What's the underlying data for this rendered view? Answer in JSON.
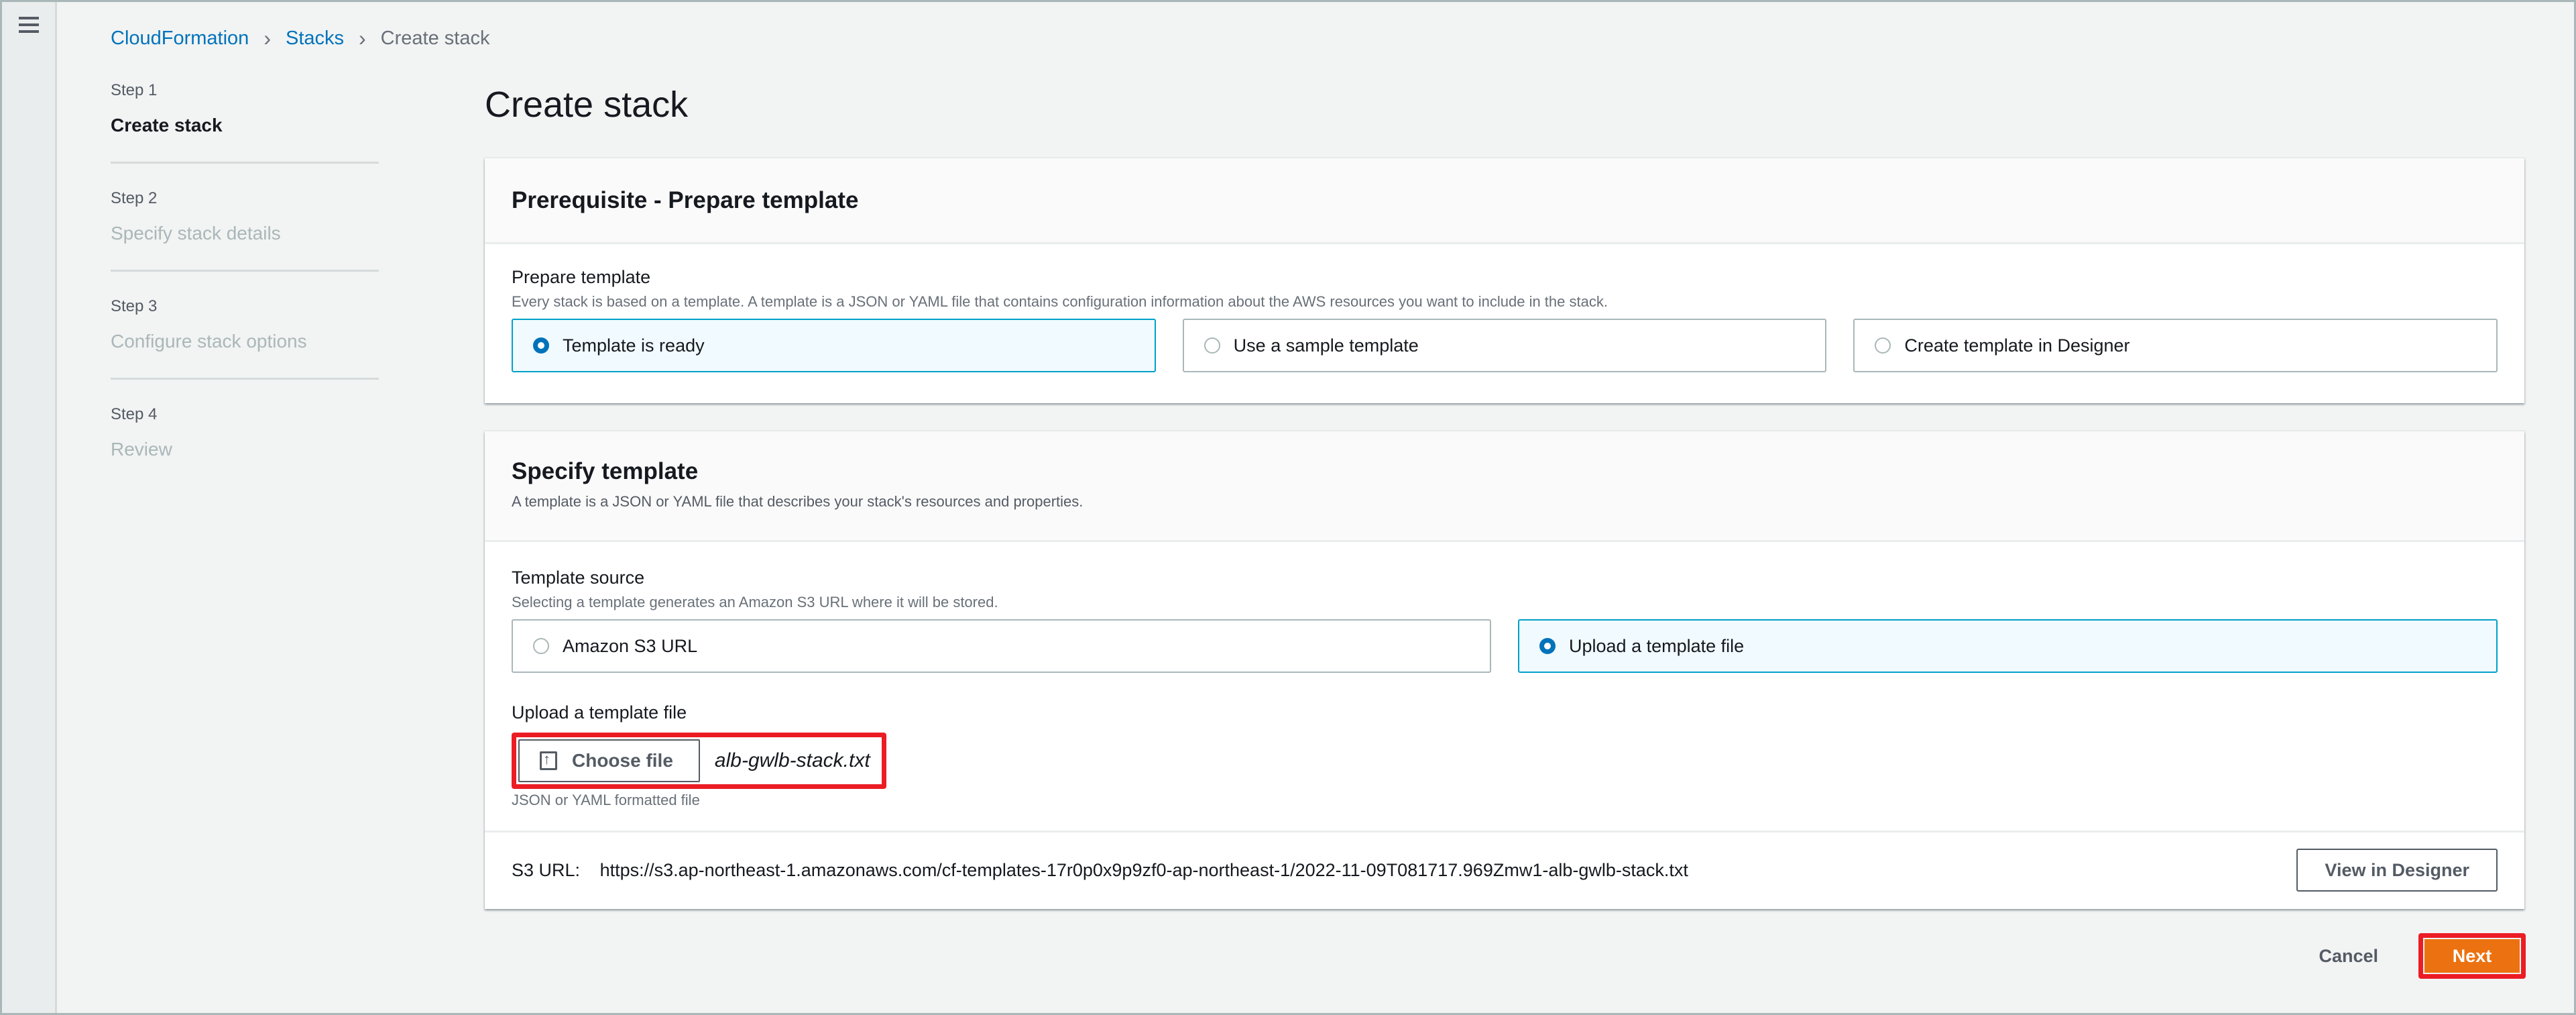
{
  "nav": {
    "menu_icon": "hamburger-menu-icon"
  },
  "breadcrumb": [
    {
      "label": "CloudFormation"
    },
    {
      "label": "Stacks"
    },
    {
      "label": "Create stack"
    }
  ],
  "steps": [
    {
      "num": "Step 1",
      "title": "Create stack",
      "active": true
    },
    {
      "num": "Step 2",
      "title": "Specify stack details",
      "active": false
    },
    {
      "num": "Step 3",
      "title": "Configure stack options",
      "active": false
    },
    {
      "num": "Step 4",
      "title": "Review",
      "active": false
    }
  ],
  "page_title": "Create stack",
  "prerequisite": {
    "title": "Prerequisite - Prepare template",
    "field_label": "Prepare template",
    "field_desc": "Every stack is based on a template. A template is a JSON or YAML file that contains configuration information about the AWS resources you want to include in the stack.",
    "options": [
      {
        "label": "Template is ready",
        "selected": true
      },
      {
        "label": "Use a sample template",
        "selected": false
      },
      {
        "label": "Create template in Designer",
        "selected": false
      }
    ]
  },
  "specify": {
    "title": "Specify template",
    "desc": "A template is a JSON or YAML file that describes your stack's resources and properties.",
    "source_label": "Template source",
    "source_desc": "Selecting a template generates an Amazon S3 URL where it will be stored.",
    "sources": [
      {
        "label": "Amazon S3 URL",
        "selected": false
      },
      {
        "label": "Upload a template file",
        "selected": true
      }
    ],
    "upload_label": "Upload a template file",
    "choose_file_label": "Choose file",
    "file_name": "alb-gwlb-stack.txt",
    "upload_hint": "JSON or YAML formatted file",
    "s3_url_label": "S3 URL:",
    "s3_url": "https://s3.ap-northeast-1.amazonaws.com/cf-templates-17r0p0x9p9zf0-ap-northeast-1/2022-11-09T081717.969Zmw1-alb-gwlb-stack.txt",
    "view_designer_label": "View in Designer"
  },
  "actions": {
    "cancel_label": "Cancel",
    "next_label": "Next"
  },
  "colors": {
    "link": "#0073bb",
    "primary": "#ec7211",
    "highlight": "#ec1c24",
    "selected_border": "#00a1c9"
  }
}
